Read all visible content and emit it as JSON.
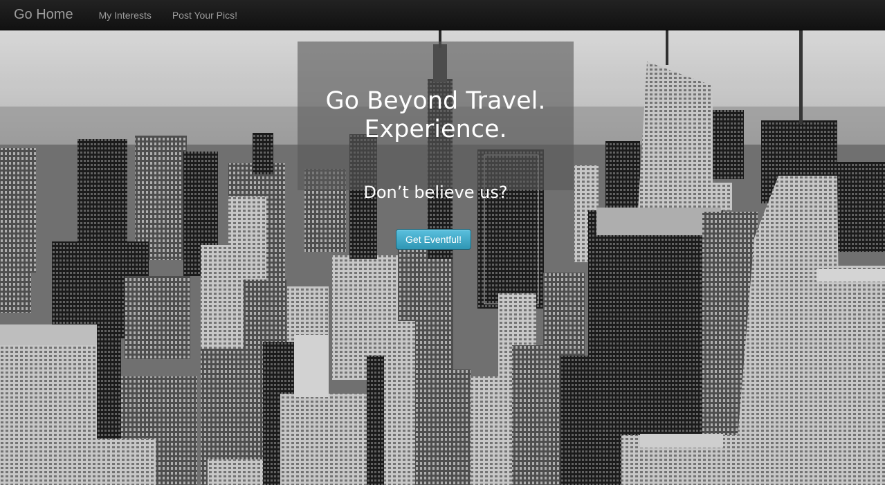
{
  "navbar": {
    "brand": "Go Home",
    "links": [
      "My Interests",
      "Post Your Pics!"
    ]
  },
  "hero": {
    "headline_line1": "Go Beyond Travel.",
    "headline_line2": "Experience.",
    "subheading": "Don’t believe us?",
    "cta_label": "Get Eventful!"
  },
  "colors": {
    "navbar_bg": "#1b1b1b",
    "nav_text": "#9d9d9d",
    "cta_top": "#5bc0de",
    "cta_bottom": "#2f96b4",
    "panel_overlay": "#5a5a5a"
  }
}
